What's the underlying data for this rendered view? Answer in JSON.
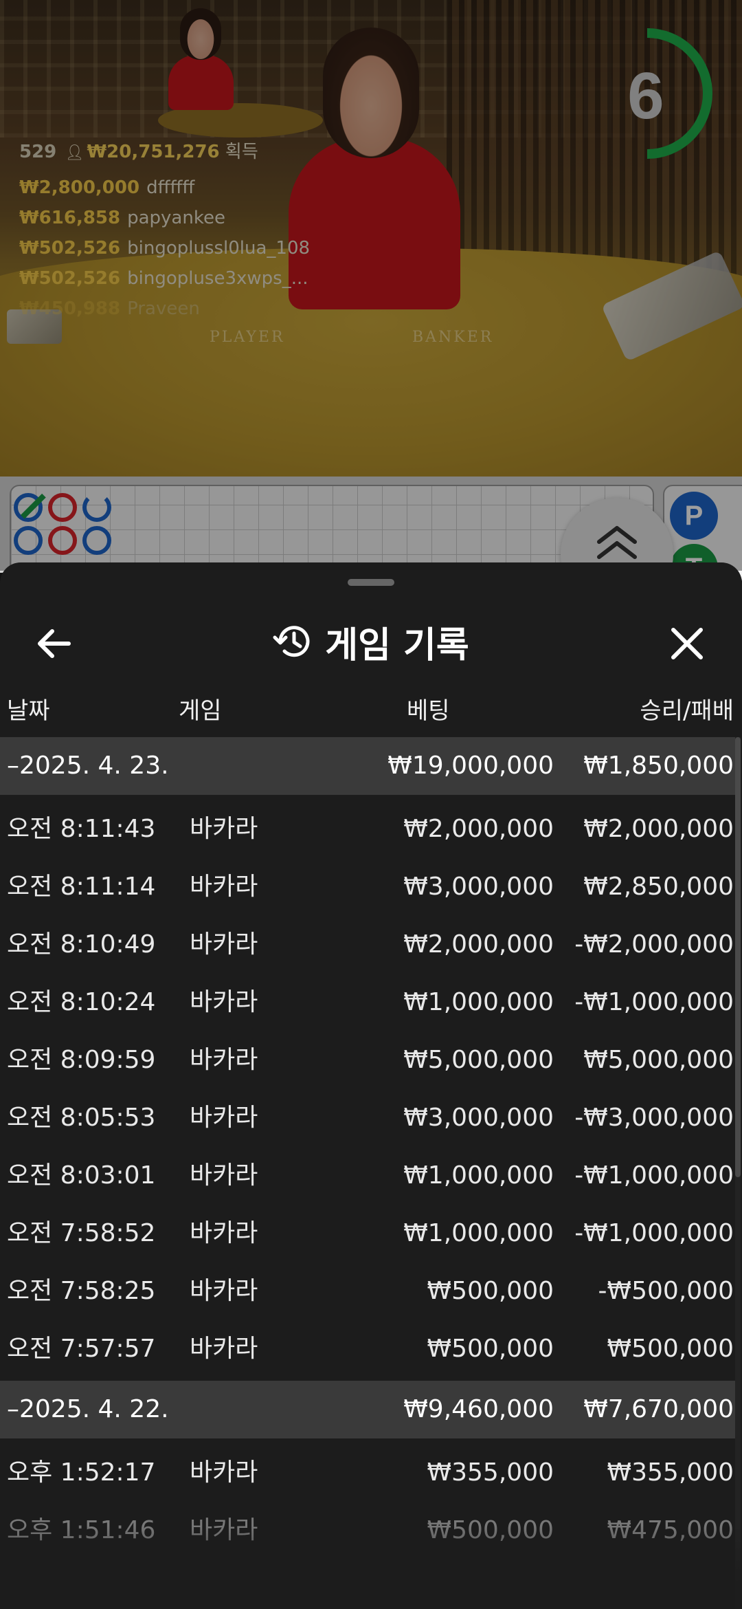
{
  "live": {
    "countdown": "6",
    "timer_color": "#1fae4b",
    "table_labels": {
      "player": "PLAYER",
      "banker": "BANKER"
    },
    "winners_summary": {
      "count": "529",
      "total": "₩20,751,276",
      "suffix": "획득"
    },
    "winners": [
      {
        "amount": "₩2,800,000",
        "name": "dffffff"
      },
      {
        "amount": "₩616,858",
        "name": "papyankee"
      },
      {
        "amount": "₩502,526",
        "name": "bingoplussl0lua_108"
      },
      {
        "amount": "₩502,526",
        "name": "bingopluse3xwps_..."
      },
      {
        "amount": "₩450,988",
        "name": "Praveen"
      }
    ]
  },
  "roadmap": {
    "side_tokens": [
      "P",
      "T"
    ],
    "colors": {
      "player": "#1d64c8",
      "banker": "#d8242a",
      "tie": "#1a9a44"
    }
  },
  "history": {
    "title": "게임 기록",
    "icons": {
      "back": "arrow-left-icon",
      "history": "history-clock-icon",
      "close": "close-icon"
    },
    "columns": {
      "date": "날짜",
      "game": "게임",
      "bet": "베팅",
      "result": "승리/패배"
    },
    "groups": [
      {
        "date": "–2025. 4. 23.",
        "bet_total": "₩19,000,000",
        "result_total": "₩1,850,000",
        "rows": [
          {
            "time": "오전 8:11:43",
            "game": "바카라",
            "bet": "₩2,000,000",
            "result": "₩2,000,000"
          },
          {
            "time": "오전 8:11:14",
            "game": "바카라",
            "bet": "₩3,000,000",
            "result": "₩2,850,000"
          },
          {
            "time": "오전 8:10:49",
            "game": "바카라",
            "bet": "₩2,000,000",
            "result": "-₩2,000,000"
          },
          {
            "time": "오전 8:10:24",
            "game": "바카라",
            "bet": "₩1,000,000",
            "result": "-₩1,000,000"
          },
          {
            "time": "오전 8:09:59",
            "game": "바카라",
            "bet": "₩5,000,000",
            "result": "₩5,000,000"
          },
          {
            "time": "오전 8:05:53",
            "game": "바카라",
            "bet": "₩3,000,000",
            "result": "-₩3,000,000"
          },
          {
            "time": "오전 8:03:01",
            "game": "바카라",
            "bet": "₩1,000,000",
            "result": "-₩1,000,000"
          },
          {
            "time": "오전 7:58:52",
            "game": "바카라",
            "bet": "₩1,000,000",
            "result": "-₩1,000,000"
          },
          {
            "time": "오전 7:58:25",
            "game": "바카라",
            "bet": "₩500,000",
            "result": "-₩500,000"
          },
          {
            "time": "오전 7:57:57",
            "game": "바카라",
            "bet": "₩500,000",
            "result": "₩500,000"
          }
        ]
      },
      {
        "date": "–2025. 4. 22.",
        "bet_total": "₩9,460,000",
        "result_total": "₩7,670,000",
        "rows": [
          {
            "time": "오후 1:52:17",
            "game": "바카라",
            "bet": "₩355,000",
            "result": "₩355,000"
          },
          {
            "time": "오후 1:51:46",
            "game": "바카라",
            "bet": "₩500,000",
            "result": "₩475,000"
          }
        ]
      }
    ]
  }
}
